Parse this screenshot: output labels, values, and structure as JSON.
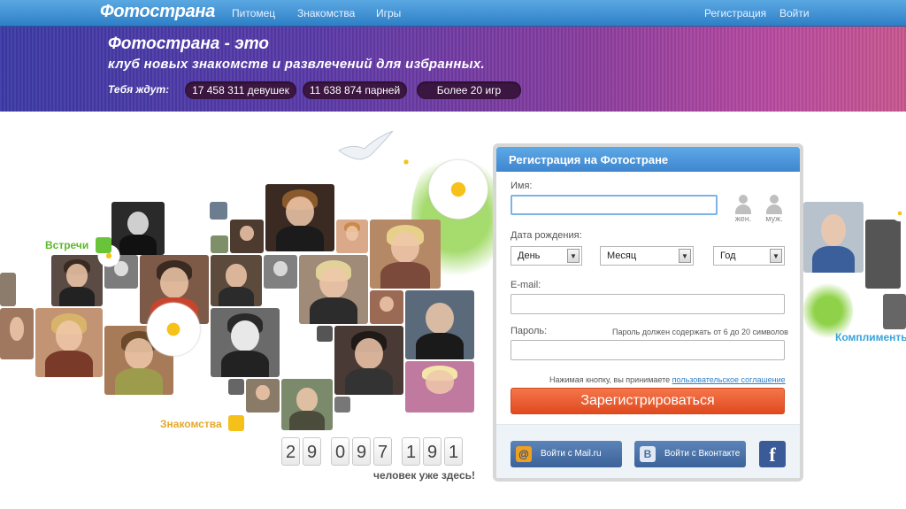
{
  "nav": {
    "logo": "Фотострана",
    "links": [
      "Питомец",
      "Знакомства",
      "Игры"
    ],
    "right_links": [
      "Регистрация",
      "Войти"
    ]
  },
  "banner": {
    "title": "Фотострана - это",
    "subtitle": "клуб новых знакомств и развлечений для избранных.",
    "await_label": "Тебя ждут:",
    "girls": "17 458 311 девушек",
    "guys": "11 638 874 парней",
    "games": "Более 20 игр"
  },
  "collage": {
    "label_meetings": "Встречи",
    "label_dating": "Знакомства",
    "label_compliments": "Комплименты"
  },
  "counter": {
    "digits": [
      "2",
      "9",
      "0",
      "9",
      "7",
      "1",
      "9",
      "1"
    ],
    "caption": "человек уже здесь!"
  },
  "registration": {
    "title": "Регистрация на Фотостране",
    "name_label": "Имя:",
    "name_value": "",
    "gender_female": "жен.",
    "gender_male": "муж.",
    "birthdate_label": "Дата рождения:",
    "day": "День",
    "month": "Месяц",
    "year": "Год",
    "email_label": "E-mail:",
    "email_value": "",
    "password_label": "Пароль:",
    "password_hint": "Пароль должен содержать от 6 до 20 символов",
    "password_value": "",
    "terms_prefix": "Нажимая кнопку, вы принимаете",
    "terms_link": "пользовательское соглашение",
    "submit": "Зарегистрироваться",
    "mailru": "Войти с Mail.ru",
    "vk": "Войти с Вконтакте",
    "facebook": "f"
  },
  "colors": {
    "nav_blue": "#2f7fc7",
    "submit_orange": "#e85a2c",
    "banner_purple": "#5a3aa8",
    "accent_green": "#5cb82a"
  }
}
